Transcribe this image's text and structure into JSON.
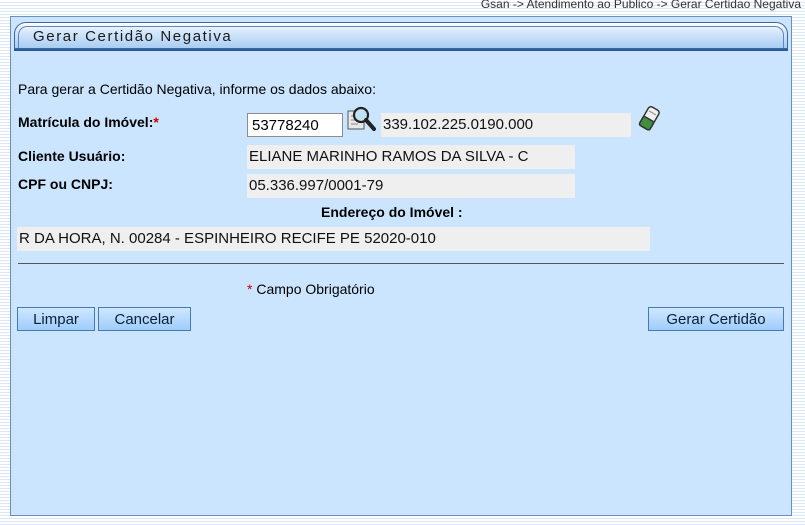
{
  "breadcrumb": "Gsan -> Atendimento ao Publico -> Gerar Certidao Negativa",
  "panel": {
    "title": "Gerar Certidão Negativa"
  },
  "form": {
    "intro": "Para gerar a Certidão Negativa, informe os dados abaixo:",
    "matricula_label": "Matrícula do Imóvel:",
    "required_mark": "*",
    "matricula_value": "53778240",
    "inscricao_value": "339.102.225.0190.000",
    "cliente_label": "Cliente Usuário:",
    "cliente_value": "ELIANE MARINHO RAMOS DA SILVA - C",
    "cpf_label": "CPF ou CNPJ:",
    "cpf_value": "05.336.997/0001-79",
    "endereco_label": "Endereço do Imóvel :",
    "endereco_value": "R DA HORA, N. 00284 - ESPINHEIRO RECIFE PE 52020-010",
    "required_note": "Campo Obrigatório"
  },
  "buttons": {
    "limpar": "Limpar",
    "cancelar": "Cancelar",
    "gerar": "Gerar Certidão"
  },
  "icons": {
    "search": "magnifier-search-icon",
    "clear": "eraser-icon"
  }
}
